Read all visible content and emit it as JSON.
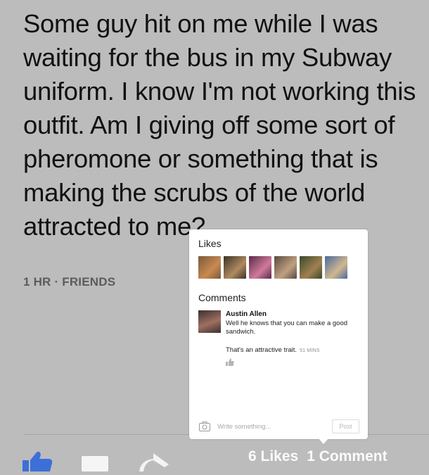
{
  "post": {
    "text": "Some guy hit on me while I was waiting for the bus in my Subway uniform. I know I'm not working this outfit. Am I giving off some sort of pheromone or something that is making the scrubs of the world attracted to me?",
    "meta": "1 HR · FRIENDS"
  },
  "footer": {
    "likes_count": "6 Likes",
    "comments_count": "1 Comment"
  },
  "popover": {
    "likes_heading": "Likes",
    "likers": [
      {
        "avatar_colors": [
          "#7a5a3a",
          "#c88a50"
        ]
      },
      {
        "avatar_colors": [
          "#3a3228",
          "#b08a60"
        ]
      },
      {
        "avatar_colors": [
          "#5a2a4a",
          "#d07a9a"
        ]
      },
      {
        "avatar_colors": [
          "#5a4a40",
          "#c0a080"
        ]
      },
      {
        "avatar_colors": [
          "#3a4a2a",
          "#a08050"
        ]
      },
      {
        "avatar_colors": [
          "#4a6a9a",
          "#d0b890"
        ]
      }
    ],
    "comments_heading": "Comments",
    "comments": [
      {
        "author": "Austin Allen",
        "text": "Well he knows that you can make a good sandwich.",
        "avatar_colors": [
          "#3a3030",
          "#a07060"
        ]
      }
    ],
    "reply": {
      "text": "That's an attractive trait.",
      "time": "51 MINS"
    },
    "write_placeholder": "Write something...",
    "post_label": "Post"
  },
  "colors": {
    "background": "#bcbcbc",
    "like_blue": "#3d6fd8",
    "popover_bg": "#ffffff"
  },
  "icons": {
    "like": "thumbs-up-icon",
    "comment": "comment-icon",
    "share": "share-arrow-icon",
    "camera": "camera-icon"
  }
}
